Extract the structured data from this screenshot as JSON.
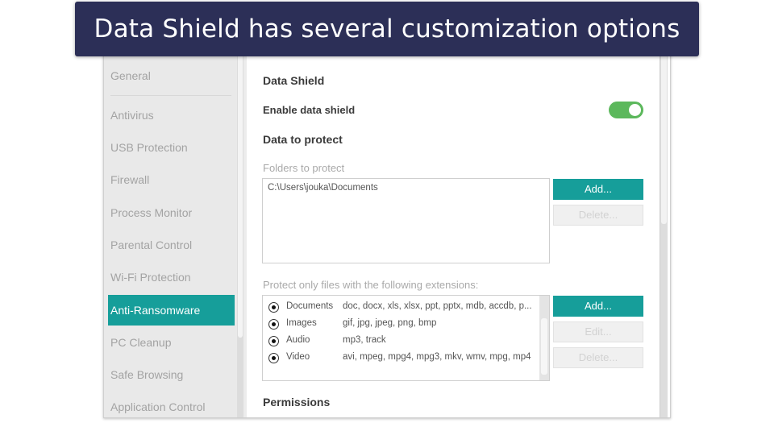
{
  "banner": {
    "text": "Data Shield has several customization options"
  },
  "sidebar": {
    "items": [
      {
        "label": "General",
        "active": false
      },
      {
        "label": "Antivirus",
        "active": false
      },
      {
        "label": "USB Protection",
        "active": false
      },
      {
        "label": "Firewall",
        "active": false
      },
      {
        "label": "Process Monitor",
        "active": false
      },
      {
        "label": "Parental Control",
        "active": false
      },
      {
        "label": "Wi-Fi Protection",
        "active": false
      },
      {
        "label": "Anti-Ransomware",
        "active": true
      },
      {
        "label": "PC Cleanup",
        "active": false
      },
      {
        "label": "Safe Browsing",
        "active": false
      },
      {
        "label": "Application Control",
        "active": false
      }
    ]
  },
  "main": {
    "section_title": "Data Shield",
    "enable_label": "Enable data shield",
    "enable_state": "on",
    "data_to_protect_title": "Data to protect",
    "folders_label": "Folders to protect",
    "folders": [
      "C:\\Users\\jouka\\Documents"
    ],
    "folder_buttons": {
      "add": "Add...",
      "delete": "Delete..."
    },
    "extensions_label": "Protect only files with the following extensions:",
    "extensions": [
      {
        "name": "Documents",
        "list": "doc, docx, xls, xlsx, ppt, pptx, mdb, accdb, p...",
        "selected": true
      },
      {
        "name": "Images",
        "list": "gif, jpg, jpeg, png, bmp",
        "selected": true
      },
      {
        "name": "Audio",
        "list": "mp3, track",
        "selected": true
      },
      {
        "name": "Video",
        "list": "avi, mpeg, mpg4, mpg3, mkv, wmv, mpg, mp4",
        "selected": true
      }
    ],
    "extension_buttons": {
      "add": "Add...",
      "edit": "Edit...",
      "delete": "Delete..."
    },
    "permissions_title": "Permissions"
  },
  "colors": {
    "accent": "#169e9a",
    "toggle_on": "#5cb85c",
    "banner_bg": "#2c2f57"
  }
}
